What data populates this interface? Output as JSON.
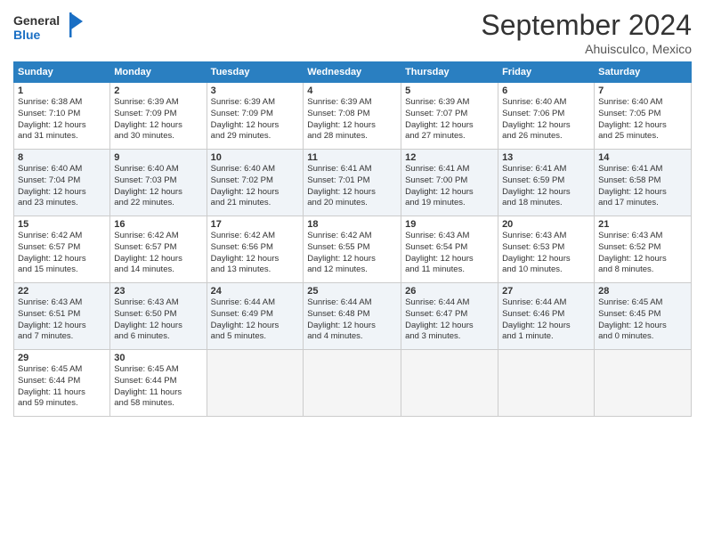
{
  "logo": {
    "general": "General",
    "blue": "Blue"
  },
  "header": {
    "month": "September 2024",
    "location": "Ahuisculco, Mexico"
  },
  "weekdays": [
    "Sunday",
    "Monday",
    "Tuesday",
    "Wednesday",
    "Thursday",
    "Friday",
    "Saturday"
  ],
  "weeks": [
    [
      {
        "day": "1",
        "info": "Sunrise: 6:38 AM\nSunset: 7:10 PM\nDaylight: 12 hours\nand 31 minutes."
      },
      {
        "day": "2",
        "info": "Sunrise: 6:39 AM\nSunset: 7:09 PM\nDaylight: 12 hours\nand 30 minutes."
      },
      {
        "day": "3",
        "info": "Sunrise: 6:39 AM\nSunset: 7:09 PM\nDaylight: 12 hours\nand 29 minutes."
      },
      {
        "day": "4",
        "info": "Sunrise: 6:39 AM\nSunset: 7:08 PM\nDaylight: 12 hours\nand 28 minutes."
      },
      {
        "day": "5",
        "info": "Sunrise: 6:39 AM\nSunset: 7:07 PM\nDaylight: 12 hours\nand 27 minutes."
      },
      {
        "day": "6",
        "info": "Sunrise: 6:40 AM\nSunset: 7:06 PM\nDaylight: 12 hours\nand 26 minutes."
      },
      {
        "day": "7",
        "info": "Sunrise: 6:40 AM\nSunset: 7:05 PM\nDaylight: 12 hours\nand 25 minutes."
      }
    ],
    [
      {
        "day": "8",
        "info": "Sunrise: 6:40 AM\nSunset: 7:04 PM\nDaylight: 12 hours\nand 23 minutes."
      },
      {
        "day": "9",
        "info": "Sunrise: 6:40 AM\nSunset: 7:03 PM\nDaylight: 12 hours\nand 22 minutes."
      },
      {
        "day": "10",
        "info": "Sunrise: 6:40 AM\nSunset: 7:02 PM\nDaylight: 12 hours\nand 21 minutes."
      },
      {
        "day": "11",
        "info": "Sunrise: 6:41 AM\nSunset: 7:01 PM\nDaylight: 12 hours\nand 20 minutes."
      },
      {
        "day": "12",
        "info": "Sunrise: 6:41 AM\nSunset: 7:00 PM\nDaylight: 12 hours\nand 19 minutes."
      },
      {
        "day": "13",
        "info": "Sunrise: 6:41 AM\nSunset: 6:59 PM\nDaylight: 12 hours\nand 18 minutes."
      },
      {
        "day": "14",
        "info": "Sunrise: 6:41 AM\nSunset: 6:58 PM\nDaylight: 12 hours\nand 17 minutes."
      }
    ],
    [
      {
        "day": "15",
        "info": "Sunrise: 6:42 AM\nSunset: 6:57 PM\nDaylight: 12 hours\nand 15 minutes."
      },
      {
        "day": "16",
        "info": "Sunrise: 6:42 AM\nSunset: 6:57 PM\nDaylight: 12 hours\nand 14 minutes."
      },
      {
        "day": "17",
        "info": "Sunrise: 6:42 AM\nSunset: 6:56 PM\nDaylight: 12 hours\nand 13 minutes."
      },
      {
        "day": "18",
        "info": "Sunrise: 6:42 AM\nSunset: 6:55 PM\nDaylight: 12 hours\nand 12 minutes."
      },
      {
        "day": "19",
        "info": "Sunrise: 6:43 AM\nSunset: 6:54 PM\nDaylight: 12 hours\nand 11 minutes."
      },
      {
        "day": "20",
        "info": "Sunrise: 6:43 AM\nSunset: 6:53 PM\nDaylight: 12 hours\nand 10 minutes."
      },
      {
        "day": "21",
        "info": "Sunrise: 6:43 AM\nSunset: 6:52 PM\nDaylight: 12 hours\nand 8 minutes."
      }
    ],
    [
      {
        "day": "22",
        "info": "Sunrise: 6:43 AM\nSunset: 6:51 PM\nDaylight: 12 hours\nand 7 minutes."
      },
      {
        "day": "23",
        "info": "Sunrise: 6:43 AM\nSunset: 6:50 PM\nDaylight: 12 hours\nand 6 minutes."
      },
      {
        "day": "24",
        "info": "Sunrise: 6:44 AM\nSunset: 6:49 PM\nDaylight: 12 hours\nand 5 minutes."
      },
      {
        "day": "25",
        "info": "Sunrise: 6:44 AM\nSunset: 6:48 PM\nDaylight: 12 hours\nand 4 minutes."
      },
      {
        "day": "26",
        "info": "Sunrise: 6:44 AM\nSunset: 6:47 PM\nDaylight: 12 hours\nand 3 minutes."
      },
      {
        "day": "27",
        "info": "Sunrise: 6:44 AM\nSunset: 6:46 PM\nDaylight: 12 hours\nand 1 minute."
      },
      {
        "day": "28",
        "info": "Sunrise: 6:45 AM\nSunset: 6:45 PM\nDaylight: 12 hours\nand 0 minutes."
      }
    ],
    [
      {
        "day": "29",
        "info": "Sunrise: 6:45 AM\nSunset: 6:44 PM\nDaylight: 11 hours\nand 59 minutes."
      },
      {
        "day": "30",
        "info": "Sunrise: 6:45 AM\nSunset: 6:44 PM\nDaylight: 11 hours\nand 58 minutes."
      },
      null,
      null,
      null,
      null,
      null
    ]
  ]
}
